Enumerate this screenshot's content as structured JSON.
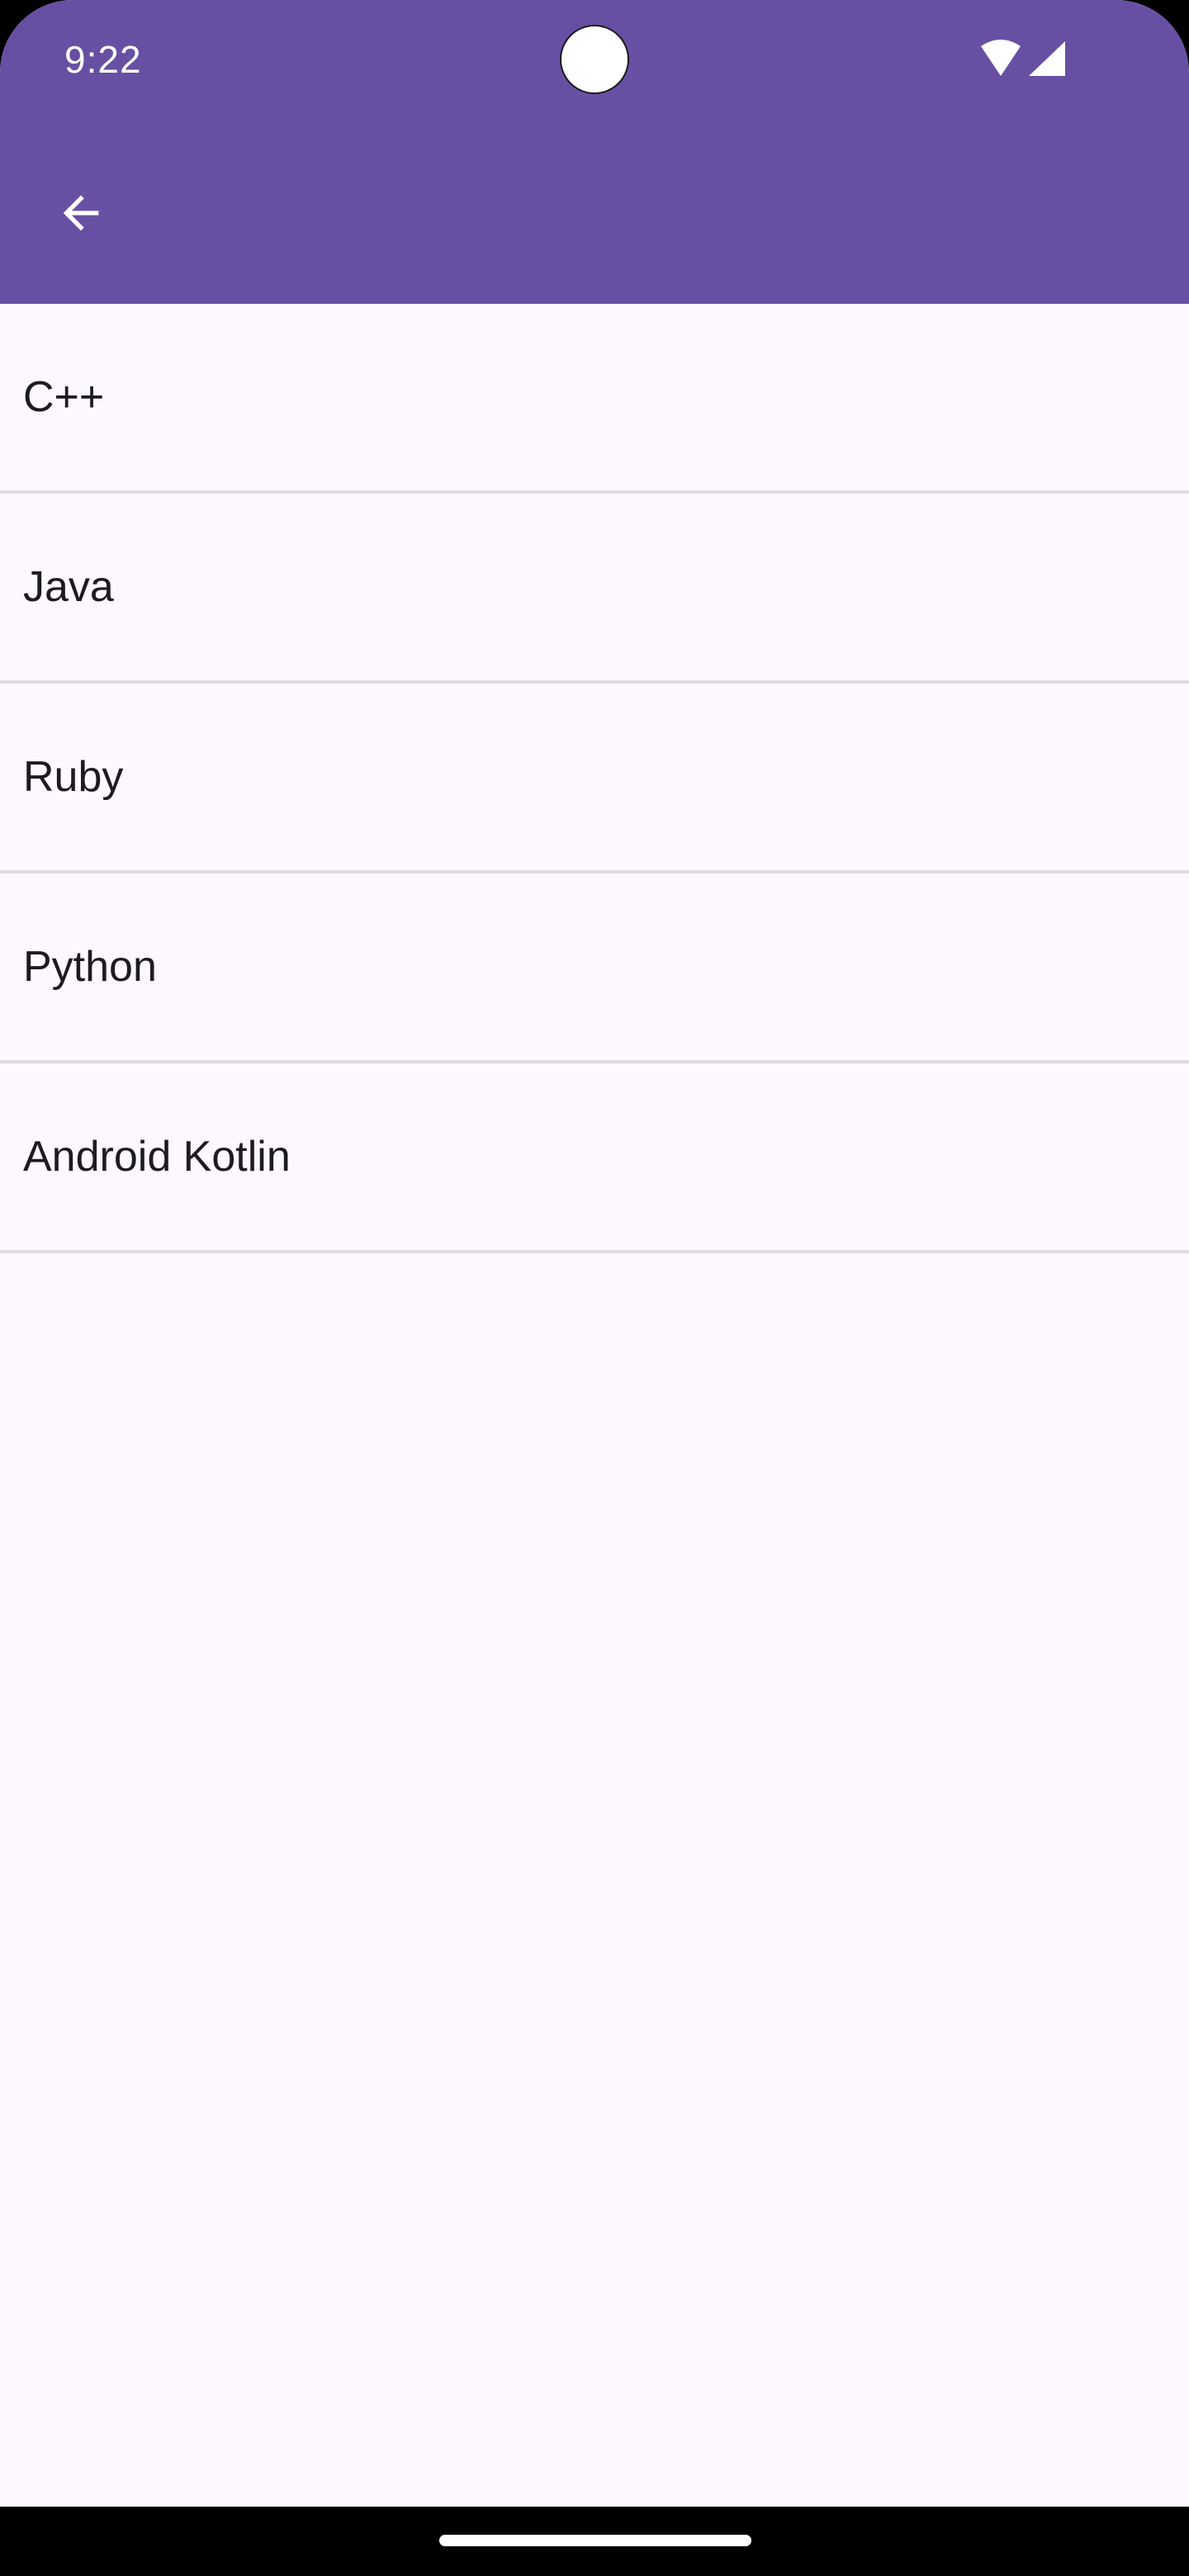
{
  "status_bar": {
    "time": "9:22",
    "icons": [
      "wifi-icon",
      "cellular-signal-icon"
    ]
  },
  "app_bar": {
    "background_color": "#6750a4",
    "navigation_icon": "arrow-back-icon"
  },
  "list": {
    "items": [
      {
        "label": "C++"
      },
      {
        "label": "Java"
      },
      {
        "label": "Ruby"
      },
      {
        "label": "Python"
      },
      {
        "label": "Android Kotlin"
      }
    ]
  },
  "colors": {
    "surface": "#fdf8fd",
    "divider": "#dcdcdc",
    "on_surface": "#1d1b20",
    "on_primary": "#ffffff"
  }
}
